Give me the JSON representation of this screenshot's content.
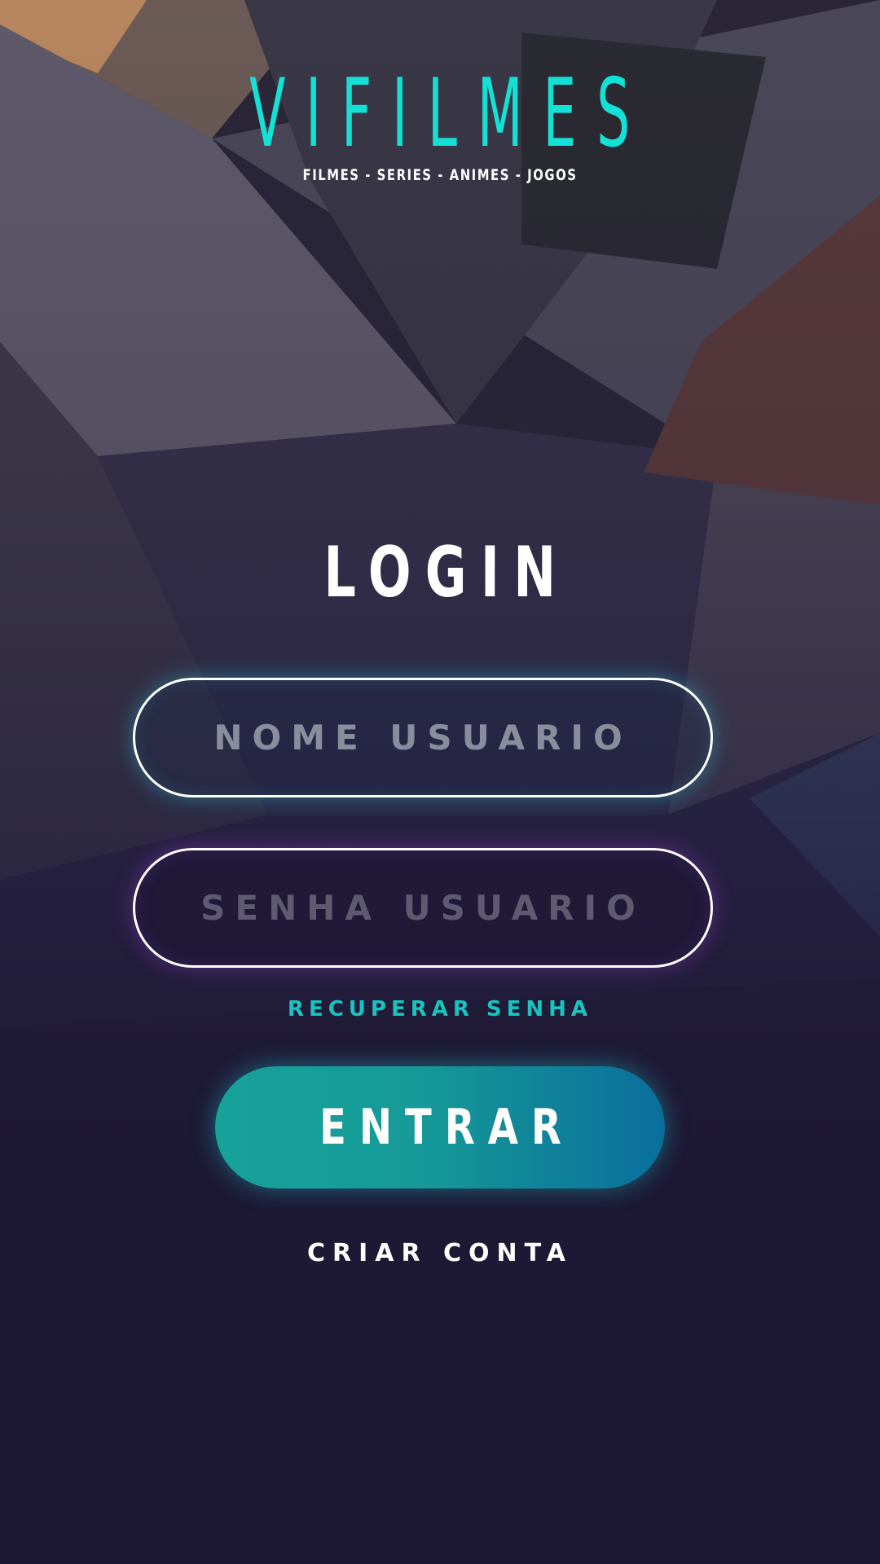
{
  "brand": {
    "title": "VIFILMES",
    "subtitle": "FILMES - SERIES - ANIMES - JOGOS"
  },
  "login": {
    "title": "LOGIN",
    "username_placeholder": "NOME USUARIO",
    "password_placeholder": "SENHA USUARIO",
    "recover_label": "RECUPERAR SENHA",
    "enter_label": "ENTRAR",
    "create_account_label": "CRIAR CONTA"
  },
  "colors": {
    "accent": "#14e1d6",
    "background": "#1c1734",
    "button_start": "#17a29a",
    "button_end": "#0a6e9c"
  }
}
